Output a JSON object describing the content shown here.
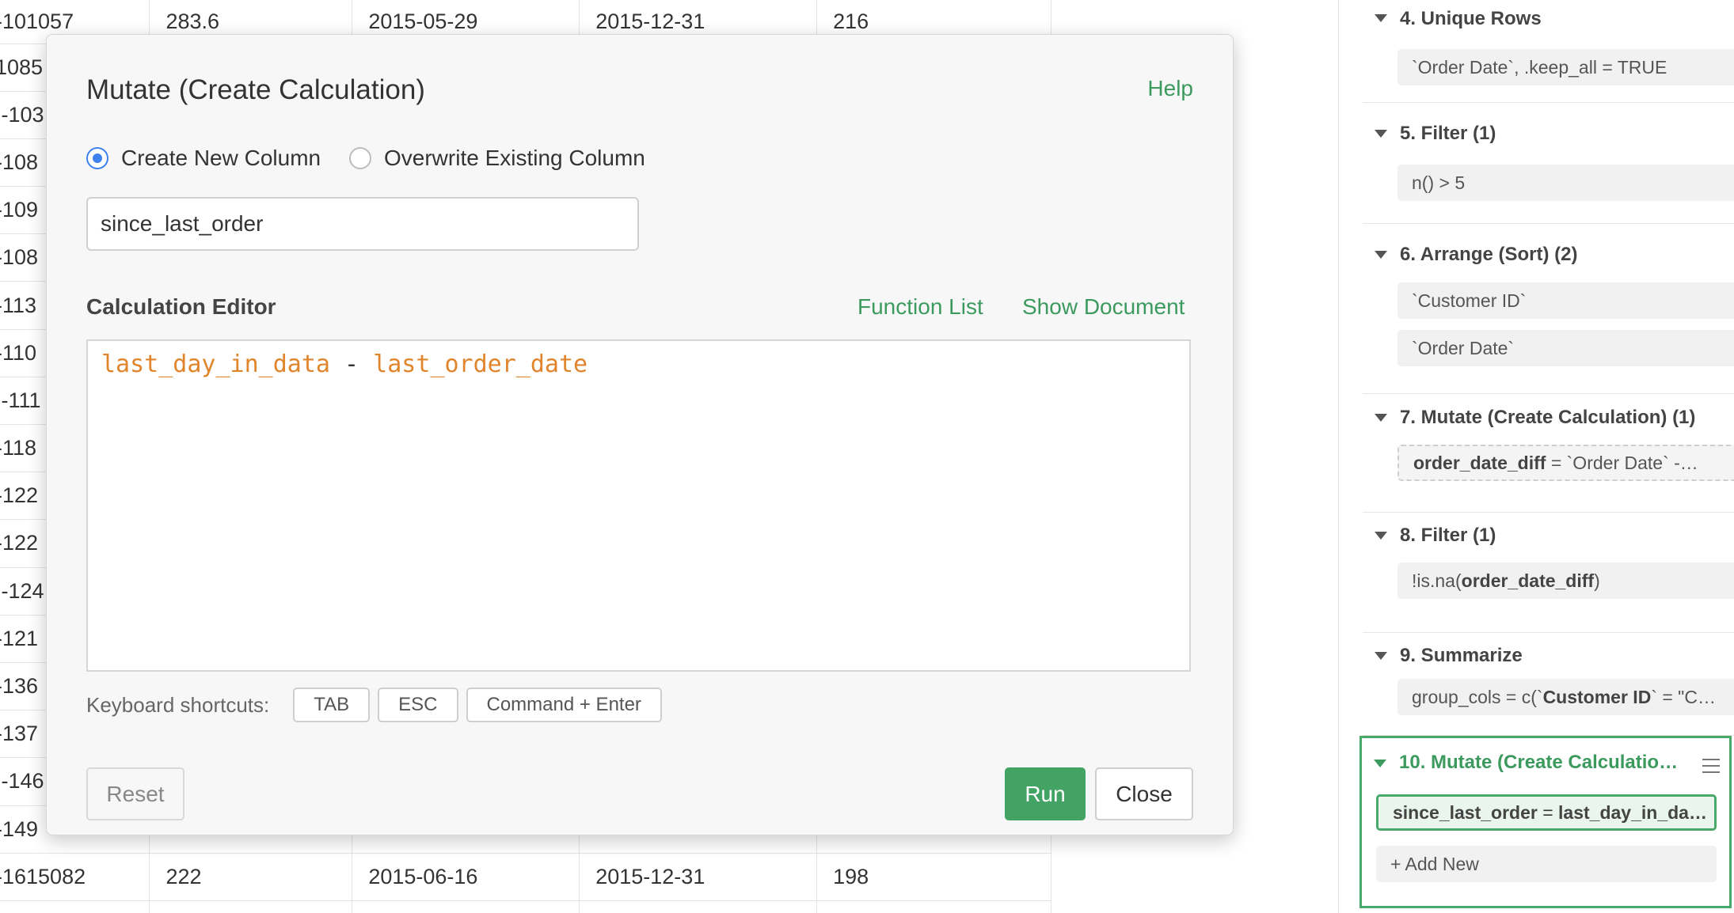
{
  "grid": {
    "rows": [
      [
        "-101057",
        "283.6",
        "2015-05-29",
        "2015-12-31",
        "216"
      ],
      [
        "1085",
        "",
        "",
        "",
        ""
      ],
      [
        "I-103",
        "",
        "",
        "",
        ""
      ],
      [
        "-108",
        "",
        "",
        "",
        ""
      ],
      [
        "-109",
        "",
        "",
        "",
        ""
      ],
      [
        "-108",
        "",
        "",
        "",
        ""
      ],
      [
        "-113",
        "",
        "",
        "",
        ""
      ],
      [
        "-110",
        "",
        "",
        "",
        ""
      ],
      [
        "I-111",
        "",
        "",
        "",
        ""
      ],
      [
        "-118",
        "",
        "",
        "",
        ""
      ],
      [
        "-122",
        "",
        "",
        "",
        ""
      ],
      [
        "-122",
        "",
        "",
        "",
        ""
      ],
      [
        "I-124",
        "",
        "",
        "",
        ""
      ],
      [
        "-121",
        "",
        "",
        "",
        ""
      ],
      [
        "-136",
        "",
        "",
        "",
        ""
      ],
      [
        "-137",
        "",
        "",
        "",
        ""
      ],
      [
        "I-146",
        "",
        "",
        "",
        ""
      ],
      [
        "-149",
        "",
        "",
        "",
        ""
      ],
      [
        "-1615082",
        "222",
        "2015-06-16",
        "2015-12-31",
        "198"
      ],
      [
        "",
        "",
        "",
        "",
        ""
      ]
    ]
  },
  "pipeline": {
    "steps": [
      {
        "title": "4. Unique Rows",
        "chips": [
          {
            "pre": "`Order Date`, .keep_all = TRUE"
          }
        ]
      },
      {
        "title": "5. Filter (1)",
        "chips": [
          {
            "pre": "n() > 5"
          }
        ]
      },
      {
        "title": "6. Arrange (Sort) (2)",
        "chips": [
          {
            "pre": "`Customer ID`"
          },
          {
            "pre": "`Order Date`"
          }
        ]
      },
      {
        "title": "7. Mutate (Create Calculation) (1)",
        "chips": [
          {
            "bold": "order_date_diff",
            "post": " = `Order Date` -…"
          }
        ]
      },
      {
        "title": "8. Filter (1)",
        "chips": [
          {
            "pre": "!is.na(",
            "bold": "order_date_diff",
            "post": ")"
          }
        ]
      },
      {
        "title": "9. Summarize",
        "chips": [
          {
            "pre": "group_cols = c(`",
            "bold": "Customer ID",
            "post": "` = \"C…"
          }
        ]
      },
      {
        "title": "10. Mutate (Create Calculatio…",
        "chips": [
          {
            "bold": "since_last_order",
            "post": " = ",
            "bold2": "last_day_in_da…"
          }
        ]
      }
    ],
    "add_new": "+ Add New"
  },
  "modal": {
    "title": "Mutate (Create Calculation)",
    "help": "Help",
    "radio_new": "Create New Column",
    "radio_overwrite": "Overwrite Existing Column",
    "column_name": "since_last_order",
    "editor_label": "Calculation Editor",
    "function_list": "Function List",
    "show_document": "Show Document",
    "code": {
      "left": "last_day_in_data",
      "op": " - ",
      "right": "last_order_date"
    },
    "shortcuts_label": "Keyboard shortcuts:",
    "keys": [
      "TAB",
      "ESC",
      "Command + Enter"
    ],
    "reset": "Reset",
    "run": "Run",
    "close": "Close"
  },
  "colors": {
    "accent": "#43a364",
    "radio": "#3e82ee",
    "code_token": "#e0852c"
  }
}
